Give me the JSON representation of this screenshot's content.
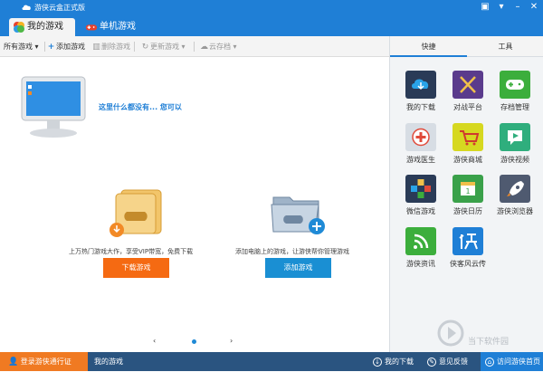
{
  "window": {
    "title": "游侠云盒正式版"
  },
  "tabs": [
    {
      "label": "我的游戏"
    },
    {
      "label": "单机游戏"
    }
  ],
  "toolbar": {
    "filter": "所有游戏",
    "add": "添加游戏",
    "delete": "删除游戏",
    "update": "更新游戏",
    "cloud": "云存档"
  },
  "main": {
    "empty_message": "这里什么都没有... 您可以",
    "download_desc": "上万热门游戏大作，享受VIP带宽，免费下载",
    "download_button": "下载游戏",
    "add_desc": "添加电脑上的游戏，让游侠帮你管理游戏",
    "add_button": "添加游戏"
  },
  "pager": {
    "prev": "‹",
    "next": "›",
    "pages": 1,
    "current": 1
  },
  "right_panel": {
    "tabs": [
      {
        "label": "快捷"
      },
      {
        "label": "工具"
      }
    ],
    "tiles": [
      {
        "label": "我的下载",
        "icon": "cloud-download-icon",
        "color": "#2a3b57"
      },
      {
        "label": "对战平台",
        "icon": "crossed-swords-icon",
        "color": "#5a3b8c"
      },
      {
        "label": "存档管理",
        "icon": "gamepad-icon",
        "color": "#3cae3c"
      },
      {
        "label": "游戏医生",
        "icon": "medical-cross-icon",
        "color": "#d7dde4"
      },
      {
        "label": "游侠商城",
        "icon": "shopping-cart-icon",
        "color": "#d6d820"
      },
      {
        "label": "游侠视频",
        "icon": "video-chat-icon",
        "color": "#2fae7d"
      },
      {
        "label": "微信游戏",
        "icon": "dpad-icon",
        "color": "#2a3b57"
      },
      {
        "label": "游侠日历",
        "icon": "calendar-icon",
        "color": "#3aa14a"
      },
      {
        "label": "游侠浏览器",
        "icon": "rocket-icon",
        "color": "#4f5a70"
      },
      {
        "label": "游侠资讯",
        "icon": "rss-icon",
        "color": "#3cae3c"
      },
      {
        "label": "侠客风云传",
        "icon": "xia-game-icon",
        "color": "#1f7fd6"
      }
    ]
  },
  "bottombar": {
    "login": "登录游侠通行证",
    "my_games": "我的游戏",
    "my_download": "我的下载",
    "feedback": "意见反馈",
    "homepage": "访问游侠首页"
  },
  "watermark": "当下软件园"
}
